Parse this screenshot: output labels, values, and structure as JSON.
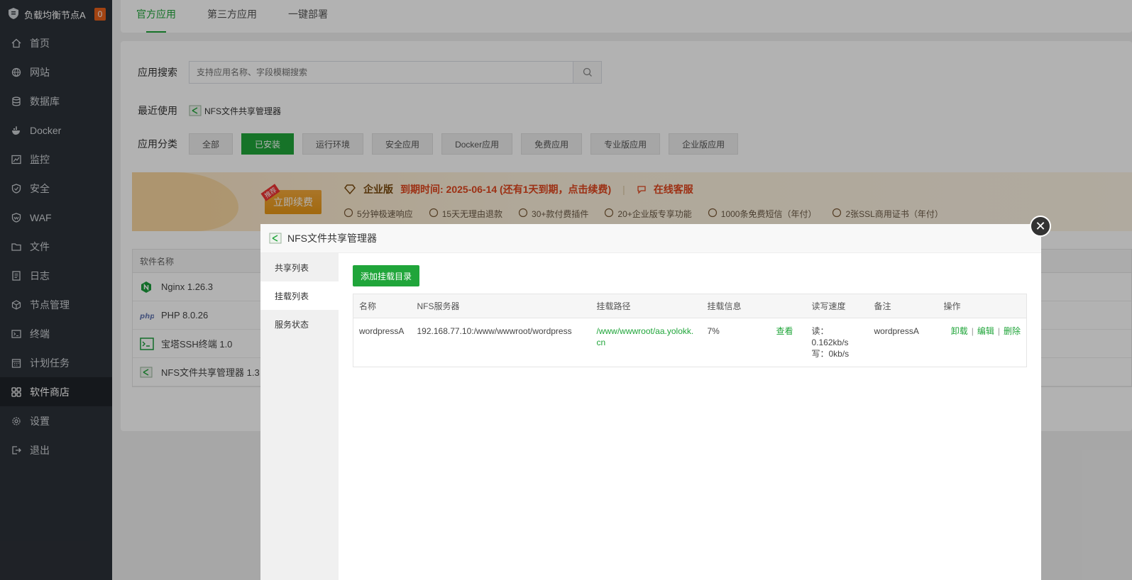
{
  "sidebar": {
    "title": "负载均衡节点A",
    "badge": "0",
    "items": [
      {
        "label": "首页",
        "icon": "home-icon"
      },
      {
        "label": "网站",
        "icon": "globe-icon"
      },
      {
        "label": "数据库",
        "icon": "database-icon"
      },
      {
        "label": "Docker",
        "icon": "docker-icon"
      },
      {
        "label": "监控",
        "icon": "monitor-icon"
      },
      {
        "label": "安全",
        "icon": "shield-icon"
      },
      {
        "label": "WAF",
        "icon": "waf-shield-icon"
      },
      {
        "label": "文件",
        "icon": "folder-icon"
      },
      {
        "label": "日志",
        "icon": "log-icon"
      },
      {
        "label": "节点管理",
        "icon": "cube-icon"
      },
      {
        "label": "终端",
        "icon": "terminal-icon"
      },
      {
        "label": "计划任务",
        "icon": "calendar-icon"
      },
      {
        "label": "软件商店",
        "icon": "grid-icon"
      },
      {
        "label": "设置",
        "icon": "gear-icon"
      },
      {
        "label": "退出",
        "icon": "logout-icon"
      }
    ],
    "active_index": 12
  },
  "tabs": [
    "官方应用",
    "第三方应用",
    "一键部署"
  ],
  "search": {
    "label": "应用搜索",
    "placeholder": "支持应用名称、字段模糊搜索"
  },
  "recent": {
    "label": "最近使用",
    "item": "NFS文件共享管理器"
  },
  "category": {
    "label": "应用分类",
    "items": [
      "全部",
      "已安装",
      "运行环境",
      "安全应用",
      "Docker应用",
      "免费应用",
      "专业版应用",
      "企业版应用"
    ],
    "active_index": 1
  },
  "banner": {
    "renew_label": "立即续费",
    "renew_tag": "推荐",
    "edition": "企业版",
    "expire": "到期时间: 2025-06-14 (还有1天到期，点击续费)",
    "service": "在线客服",
    "features": [
      "5分钟极速响应",
      "15天无理由退款",
      "30+款付费插件",
      "20+企业版专享功能",
      "1000条免费短信（年付）",
      "2张SSL商用证书（年付）"
    ]
  },
  "soft_list": {
    "header": "软件名称",
    "rows": [
      "Nginx 1.26.3",
      "PHP 8.0.26",
      "宝塔SSH终端 1.0",
      "NFS文件共享管理器 1.3"
    ]
  },
  "modal": {
    "title": "NFS文件共享管理器",
    "side_tabs": [
      "共享列表",
      "挂载列表",
      "服务状态"
    ],
    "active_side": 1,
    "add_button": "添加挂载目录",
    "columns": [
      "名称",
      "NFS服务器",
      "挂载路径",
      "挂载信息",
      "读写速度",
      "备注",
      "操作"
    ],
    "row": {
      "name": "wordpressA",
      "server": "192.168.77.10:/www/wwwroot/wordpress",
      "path": "/www/wwwroot/aa.yolokk.cn",
      "info": "7%",
      "view": "查看",
      "read": "读：0.162kb/s",
      "write": "写：0kb/s",
      "remark": "wordpressA",
      "op_unmount": "卸载",
      "op_edit": "编辑",
      "op_delete": "删除"
    }
  },
  "colors": {
    "accent": "#20a53a",
    "sidebar_bg": "#2c3138",
    "warning": "#e0461d"
  }
}
